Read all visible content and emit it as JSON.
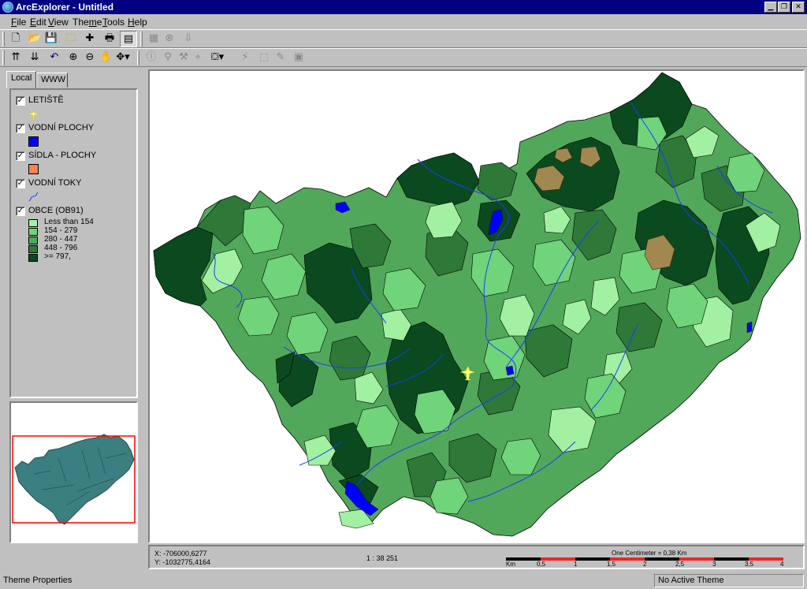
{
  "window": {
    "title": "ArcExplorer - Untitled"
  },
  "menu": [
    {
      "key": "F",
      "rest": "ile"
    },
    {
      "key": "E",
      "rest": "dit"
    },
    {
      "key": "V",
      "rest": "iew"
    },
    {
      "pre": "The",
      "key": "m",
      "rest": "e"
    },
    {
      "key": "T",
      "rest": "ools"
    },
    {
      "key": "H",
      "rest": "elp"
    }
  ],
  "tabs": {
    "local": "Local",
    "www": "WWW"
  },
  "legend": {
    "letiste": "LETIŠTĚ",
    "vodni_plochy": "VODNÍ PLOCHY",
    "sidla": "SÍDLA - PLOCHY",
    "vodni_toky": "VODNÍ TOKY",
    "obce": "OBCE (OB91)",
    "classes": [
      "Less than 154",
      "154 - 279",
      "280 - 447",
      "448 - 796",
      ">= 797,"
    ]
  },
  "colors": {
    "classes": [
      "#a2f0a2",
      "#6fd47a",
      "#52a85a",
      "#2e7838",
      "#0a4a1e"
    ],
    "water": "#0000ff",
    "settlement": "#a08850",
    "river": "#1a3cff",
    "airport": "#ffff66"
  },
  "info": {
    "x_coord": "X: -706000,6277",
    "y_coord": "Y: -1032775,4164",
    "scale_ratio": "1 : 38 251",
    "scale_title": "One Centimeter = 0,38 Km",
    "scale_labels": [
      "Km",
      "0,5",
      "1",
      "1,5",
      "2",
      "2,5",
      "3",
      "3,5",
      "4"
    ]
  },
  "status": {
    "left": "Theme Properties",
    "right": "No Active Theme"
  }
}
